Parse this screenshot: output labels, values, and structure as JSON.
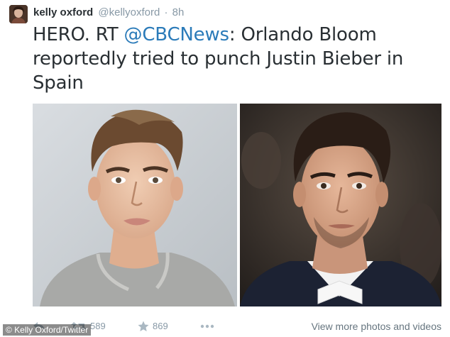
{
  "tweet": {
    "author_name": "kelly oxford",
    "author_handle": "@kellyoxford",
    "separator": "·",
    "time": "8h",
    "text_before": "HERO. RT ",
    "mention": "@CBCNews",
    "text_after": ": Orlando Bloom reportedly tried to punch Justin Bieber in Spain"
  },
  "actions": {
    "retweet_count": "589",
    "favorite_count": "869",
    "view_more": "View more photos and videos"
  },
  "credit": "© Kelly Oxford/Twitter",
  "icons": {
    "reply": "reply-icon",
    "retweet": "retweet-icon",
    "favorite": "star-icon",
    "more": "more-dots-icon"
  },
  "colors": {
    "link": "#2b7bb9",
    "meta": "#8899a6",
    "text": "#292f33"
  }
}
